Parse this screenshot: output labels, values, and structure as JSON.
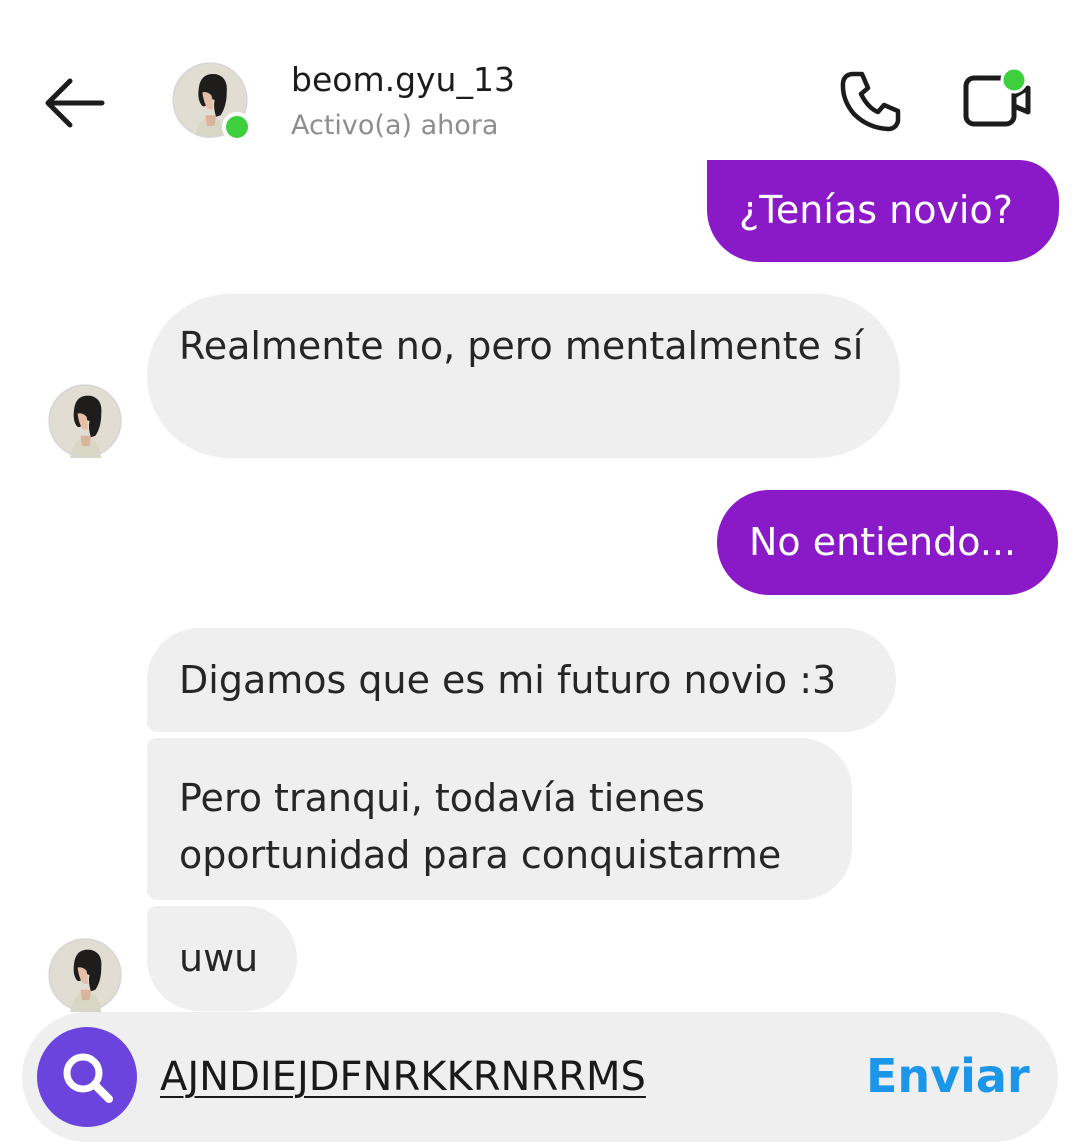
{
  "header": {
    "username": "beom.gyu_13",
    "status": "Activo(a) ahora",
    "back_icon": "arrow-left-icon",
    "call_icon": "phone-icon",
    "video_icon": "video-camera-icon"
  },
  "messages": [
    {
      "from": "me",
      "text": "¿Tenías novio?"
    },
    {
      "from": "them",
      "text": "Realmente no, pero mentalmente sí"
    },
    {
      "from": "me",
      "text": "No entiendo..."
    },
    {
      "from": "them",
      "text": "Digamos que es mi futuro novio :3"
    },
    {
      "from": "them",
      "text": "Pero tranqui, todavía tienes oportunidad para conquistarme"
    },
    {
      "from": "them",
      "text": "uwu"
    }
  ],
  "composer": {
    "icon": "search-icon",
    "value": "AJNDIEJDFNRKKRNRRMS",
    "send_label": "Enviar"
  },
  "colors": {
    "sent_bubble": "#8a1ac8",
    "received_bubble": "#efefef",
    "online": "#3ecf3e",
    "send": "#1c96e8",
    "camera_button": "#6a44dc"
  }
}
